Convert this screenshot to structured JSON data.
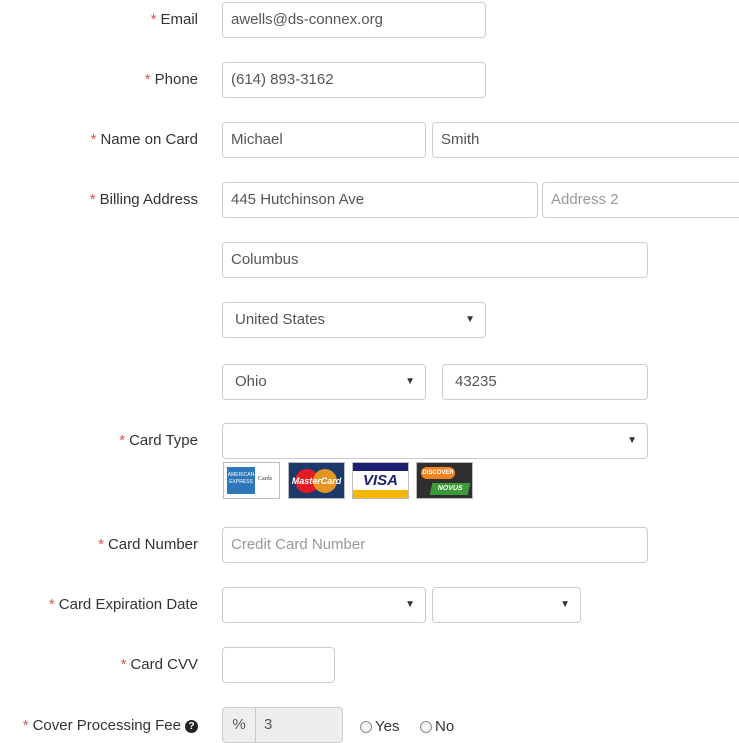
{
  "form": {
    "email": {
      "label": "Email",
      "value": "awells@ds-connex.org"
    },
    "phone": {
      "label": "Phone",
      "value": "(614) 893-3162"
    },
    "name_on_card": {
      "label": "Name on Card",
      "first": "Michael",
      "last": "Smith"
    },
    "billing_address": {
      "label": "Billing Address",
      "address1": "445 Hutchinson Ave",
      "address2_placeholder": "Address 2",
      "city": "Columbus",
      "country": "United States",
      "state": "Ohio",
      "zip": "43235"
    },
    "card_type": {
      "label": "Card Type",
      "value": "",
      "cards": [
        {
          "name": "american-express",
          "text": "AMERICAN EXPRESS",
          "color": "#2e77bb"
        },
        {
          "name": "mastercard",
          "text": "MasterCard",
          "color": "#e9a23b"
        },
        {
          "name": "visa",
          "text": "VISA",
          "color": "#1a1f71"
        },
        {
          "name": "discover-novus",
          "text": "DISCOVER",
          "color": "#f58220"
        }
      ]
    },
    "card_number": {
      "label": "Card Number",
      "placeholder": "Credit Card Number"
    },
    "card_expiration": {
      "label": "Card Expiration Date",
      "month": "",
      "year": ""
    },
    "card_cvv": {
      "label": "Card CVV",
      "value": ""
    },
    "cover_fee": {
      "label": "Cover Processing Fee",
      "help": "?",
      "addon": "%",
      "value": "3",
      "yes_label": "Yes",
      "no_label": "No"
    }
  },
  "colors": {
    "required": "#d9534f",
    "border": "#cccccc",
    "text": "#333333",
    "placeholder": "#999999"
  }
}
